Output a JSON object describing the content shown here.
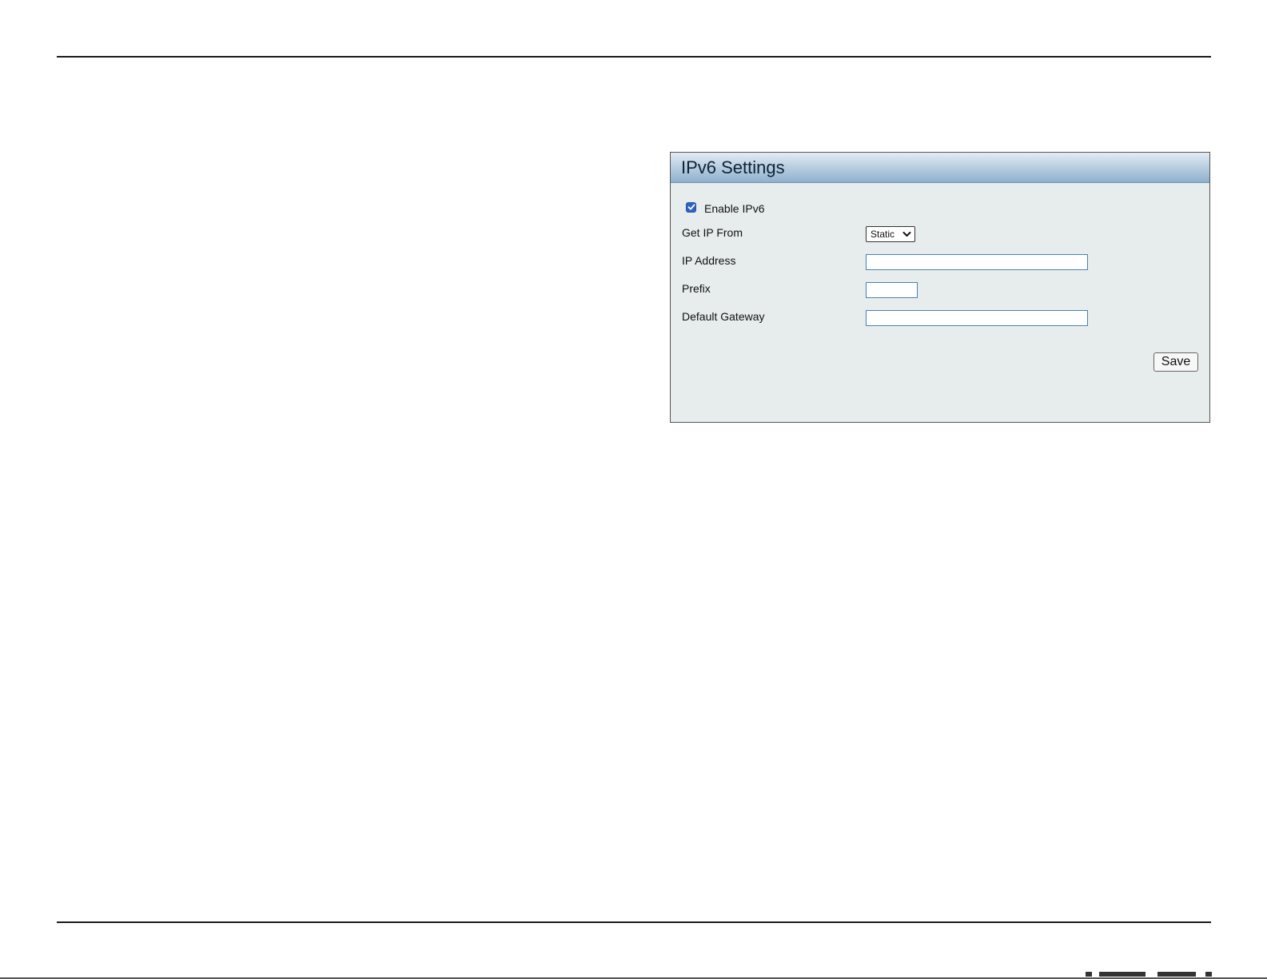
{
  "panel": {
    "title": "IPv6 Settings",
    "enable_ipv6": {
      "label": "Enable IPv6",
      "checked": true
    },
    "fields": {
      "get_ip_from": {
        "label": "Get IP From",
        "selected": "Static"
      },
      "ip_address": {
        "label": "IP Address",
        "value": ""
      },
      "prefix": {
        "label": "Prefix",
        "value": ""
      },
      "default_gateway": {
        "label": "Default Gateway",
        "value": ""
      }
    },
    "save_label": "Save"
  },
  "colors": {
    "panel_background": "#e6edec",
    "header_gradient_top": "#e3ecf4",
    "header_gradient_bottom": "#8fb1cc",
    "checkbox_accent": "#2f63c6",
    "input_border": "#4a7fb8"
  }
}
